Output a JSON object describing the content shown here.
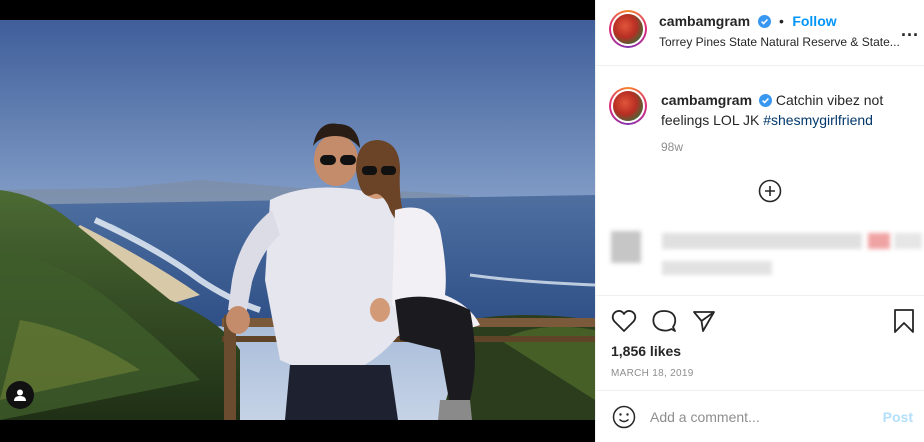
{
  "post": {
    "username": "cambamgram",
    "follow_label": "Follow",
    "separator": "•",
    "location": "Torrey Pines State Natural Reserve & State...",
    "more_label": "...",
    "caption_text": "Catchin vibez not feelings LOL JK",
    "caption_hashtag": "#shesmygirlfriend",
    "caption_age": "98w",
    "likes": "1,856 likes",
    "date": "MARCH 18, 2019"
  },
  "comment": {
    "placeholder": "Add a comment...",
    "post_label": "Post"
  },
  "icons": {
    "verified": "verified-badge-icon",
    "load_more": "plus-circle-icon",
    "like": "heart-icon",
    "comment": "comment-icon",
    "share": "share-icon",
    "save": "bookmark-icon",
    "emoji": "emoji-icon",
    "tag": "user-tag-icon"
  },
  "colors": {
    "accent": "#0095f6",
    "hashtag": "#00376b",
    "muted": "#8e8e8e",
    "post_disabled": "#b2dffc"
  }
}
